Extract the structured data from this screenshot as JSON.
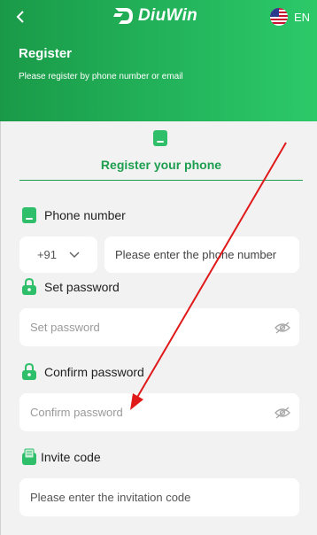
{
  "header": {
    "logo_text": "DiuWin",
    "lang_label": "EN",
    "title": "Register",
    "subtitle": "Please register by phone number or email"
  },
  "tab": {
    "label": "Register your phone"
  },
  "form": {
    "phone": {
      "label": "Phone number",
      "country_code": "+91",
      "placeholder": "Please enter the phone number"
    },
    "password": {
      "label": "Set password",
      "placeholder": "Set password"
    },
    "confirm": {
      "label": "Confirm password",
      "placeholder": "Confirm password"
    },
    "invite": {
      "label": "Invite code",
      "placeholder": "Please enter the invitation code"
    }
  },
  "colors": {
    "brand_green": "#23b45b",
    "tab_green": "#1e9e4f",
    "annotation_arrow": "#e01a1a"
  },
  "icons": [
    "chevron-left-icon",
    "diuwin-logo-icon",
    "us-flag-icon",
    "phone-icon",
    "lock-icon",
    "eye-off-icon",
    "chevron-down-icon",
    "invite-icon"
  ]
}
